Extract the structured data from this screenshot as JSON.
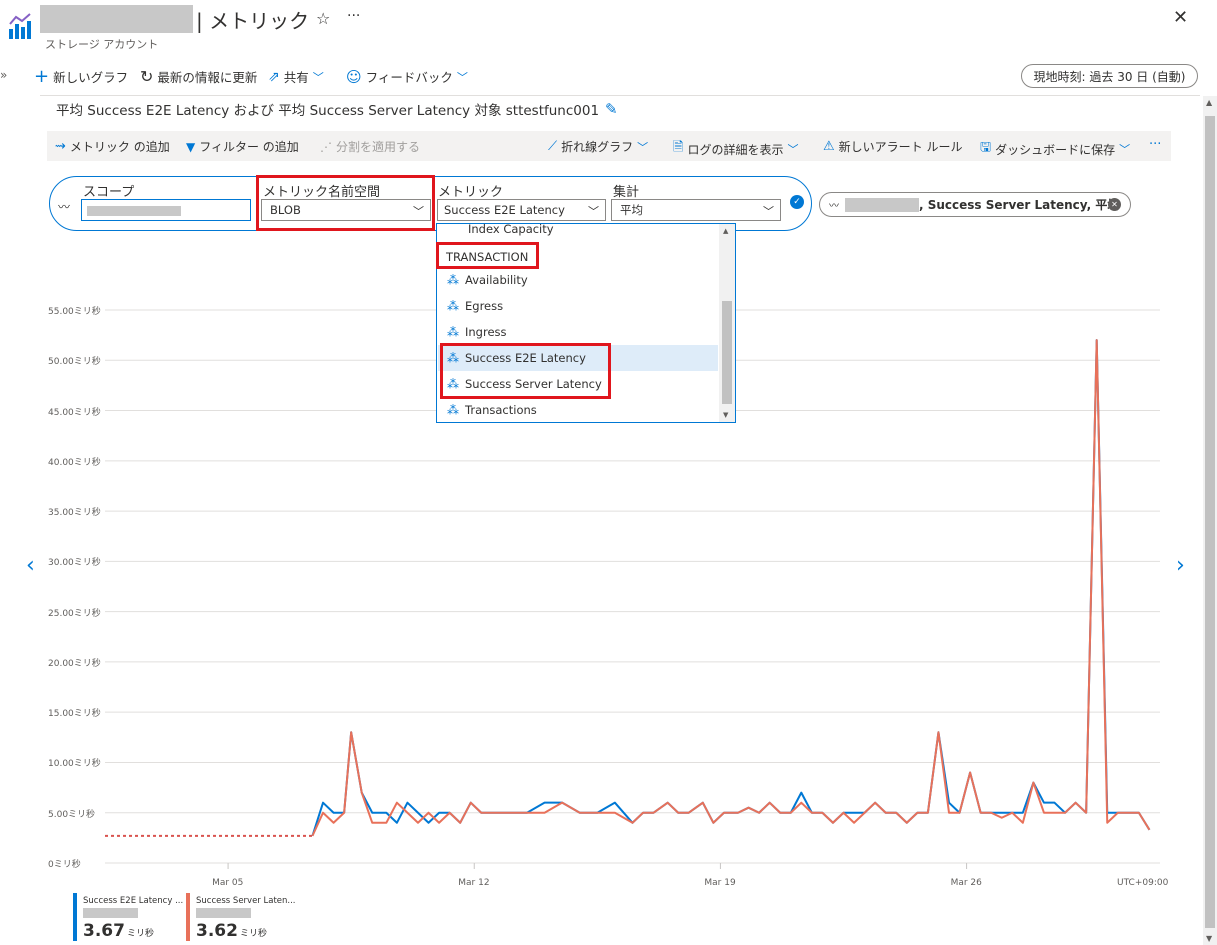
{
  "header": {
    "title_suffix": "| メトリック",
    "subtitle": "ストレージ アカウント"
  },
  "toolbar": {
    "new_chart": "新しいグラフ",
    "refresh": "最新の情報に更新",
    "share": "共有",
    "feedback": "フィードバック",
    "time_range": "現地時刻: 過去 30 日 (自動)"
  },
  "chart_title": "平均 Success E2E Latency および 平均 Success Server Latency 対象 sttestfunc001",
  "commands": {
    "add_metric": "メトリック の追加",
    "add_filter": "フィルター の追加",
    "apply_split": "分割を適用する",
    "line_chart": "折れ線グラフ",
    "show_logs": "ログの詳細を表示",
    "new_alert": "新しいアラート ルール",
    "save_dashboard": "ダッシュボードに保存"
  },
  "metric_builder": {
    "scope_label": "スコープ",
    "namespace_label": "メトリック名前空間",
    "namespace_value": "BLOB",
    "metric_label": "メトリック",
    "metric_value": "Success E2E Latency",
    "aggregation_label": "集計",
    "aggregation_value": "平均"
  },
  "metric_pill": {
    "text": ", Success Server Latency, 平均"
  },
  "dropdown": {
    "partial_item": "Index Capacity",
    "group_header": "TRANSACTION",
    "items": [
      "Availability",
      "Egress",
      "Ingress",
      "Success E2E Latency",
      "Success Server Latency",
      "Transactions"
    ],
    "selected": "Success E2E Latency"
  },
  "legend": [
    {
      "name": "Success E2E Latency ...",
      "value": "3.67",
      "unit": "ミリ秒",
      "color": "#0078d4"
    },
    {
      "name": "Success Server Laten...",
      "value": "3.62",
      "unit": "ミリ秒",
      "color": "#e8715a"
    }
  ],
  "chart_data": {
    "type": "line",
    "y_tick_labels": [
      "0ミリ秒",
      "5.00ミリ秒",
      "10.00ミリ秒",
      "15.00ミリ秒",
      "20.00ミリ秒",
      "25.00ミリ秒",
      "30.00ミリ秒",
      "35.00ミリ秒",
      "40.00ミリ秒",
      "45.00ミリ秒",
      "50.00ミリ秒",
      "55.00ミリ秒"
    ],
    "x_tick_labels": [
      "Mar 05",
      "Mar 12",
      "Mar 19",
      "Mar 26"
    ],
    "timezone_label": "UTC+09:00",
    "ylim": [
      0,
      55
    ],
    "xlim": [
      0,
      30
    ],
    "x_ticks": [
      3.5,
      10.5,
      17.5,
      24.5
    ],
    "grid": true,
    "dashed_segment": {
      "x": [
        0,
        5.9
      ],
      "y": [
        2.7,
        2.7
      ]
    },
    "series": [
      {
        "name": "Success E2E Latency",
        "color": "#0078d4",
        "x": [
          5.9,
          6.2,
          6.5,
          6.8,
          7.0,
          7.3,
          7.6,
          8.0,
          8.3,
          8.6,
          8.9,
          9.2,
          9.5,
          9.8,
          10.1,
          10.4,
          10.7,
          11.0,
          11.5,
          12.0,
          12.5,
          13.0,
          13.5,
          14.0,
          14.5,
          15.0,
          15.3,
          15.6,
          16.0,
          16.3,
          16.6,
          17.0,
          17.3,
          17.6,
          18.0,
          18.3,
          18.6,
          18.9,
          19.2,
          19.5,
          19.8,
          20.1,
          20.4,
          20.7,
          21.0,
          21.3,
          21.6,
          21.9,
          22.2,
          22.5,
          22.8,
          23.1,
          23.4,
          23.7,
          24.0,
          24.3,
          24.6,
          24.9,
          25.2,
          25.5,
          25.8,
          26.1,
          26.4,
          26.7,
          27.0,
          27.3,
          27.6,
          27.9,
          28.2,
          28.5,
          28.8,
          29.1,
          29.4,
          29.7
        ],
        "y": [
          2.7,
          6.0,
          5.0,
          5.0,
          13.0,
          7.0,
          5.0,
          5.0,
          4.0,
          6.0,
          5.0,
          4.0,
          5.0,
          5.0,
          4.0,
          6.0,
          5.0,
          5.0,
          5.0,
          5.0,
          6.0,
          6.0,
          5.0,
          5.0,
          6.0,
          4.0,
          5.0,
          5.0,
          6.0,
          5.0,
          5.0,
          6.0,
          4.0,
          5.0,
          5.0,
          5.5,
          5.0,
          6.0,
          5.0,
          5.0,
          7.0,
          5.0,
          5.0,
          4.0,
          5.0,
          5.0,
          5.0,
          6.0,
          5.0,
          5.0,
          4.0,
          5.0,
          5.0,
          13.0,
          6.0,
          5.0,
          9.0,
          5.0,
          5.0,
          5.0,
          5.0,
          5.0,
          8.0,
          6.0,
          6.0,
          5.0,
          6.0,
          5.0,
          52.0,
          5.0,
          5.0,
          5.0,
          5.0,
          3.3
        ]
      },
      {
        "name": "Success Server Latency",
        "color": "#e8715a",
        "x": [
          5.9,
          6.2,
          6.5,
          6.8,
          7.0,
          7.3,
          7.6,
          8.0,
          8.3,
          8.6,
          8.9,
          9.2,
          9.5,
          9.8,
          10.1,
          10.4,
          10.7,
          11.0,
          11.5,
          12.0,
          12.5,
          13.0,
          13.5,
          14.0,
          14.5,
          15.0,
          15.3,
          15.6,
          16.0,
          16.3,
          16.6,
          17.0,
          17.3,
          17.6,
          18.0,
          18.3,
          18.6,
          18.9,
          19.2,
          19.5,
          19.8,
          20.1,
          20.4,
          20.7,
          21.0,
          21.3,
          21.6,
          21.9,
          22.2,
          22.5,
          22.8,
          23.1,
          23.4,
          23.7,
          24.0,
          24.3,
          24.6,
          24.9,
          25.2,
          25.5,
          25.8,
          26.1,
          26.4,
          26.7,
          27.0,
          27.3,
          27.6,
          27.9,
          28.2,
          28.5,
          28.8,
          29.1,
          29.4,
          29.7
        ],
        "y": [
          2.7,
          5.0,
          4.0,
          5.0,
          13.0,
          7.0,
          4.0,
          4.0,
          6.0,
          5.0,
          4.0,
          5.0,
          4.0,
          5.0,
          4.0,
          6.0,
          5.0,
          5.0,
          5.0,
          5.0,
          5.0,
          6.0,
          5.0,
          5.0,
          5.0,
          4.0,
          5.0,
          5.0,
          6.0,
          5.0,
          5.0,
          6.0,
          4.0,
          5.0,
          5.0,
          5.5,
          5.0,
          6.0,
          5.0,
          5.0,
          6.0,
          5.0,
          5.0,
          4.0,
          5.0,
          4.0,
          5.0,
          6.0,
          5.0,
          5.0,
          4.0,
          5.0,
          5.0,
          13.0,
          5.0,
          5.0,
          9.0,
          5.0,
          5.0,
          4.5,
          5.0,
          4.0,
          8.0,
          5.0,
          5.0,
          5.0,
          6.0,
          5.0,
          52.0,
          4.0,
          5.0,
          5.0,
          5.0,
          3.3
        ]
      }
    ]
  }
}
